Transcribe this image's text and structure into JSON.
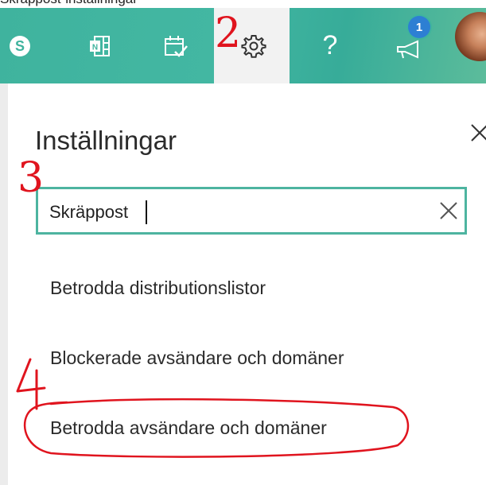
{
  "page": {
    "caption": "Skräppost-inställningar"
  },
  "header": {
    "icons": [
      "skype-icon",
      "onenote-icon",
      "todo-icon",
      "settings-gear-icon",
      "help-icon",
      "announcement-icon",
      "avatar"
    ],
    "help_label": "?",
    "notification_count": "1",
    "colors": {
      "bar": "#43b7a2",
      "active": "#f2f2f2",
      "badge": "#2d7fd3"
    }
  },
  "settings_panel": {
    "title": "Inställningar",
    "search": {
      "value": "Skräppost",
      "placeholder": ""
    },
    "results": [
      {
        "label": "Betrodda distributionslistor"
      },
      {
        "label": "Blockerade avsändare och domäner"
      },
      {
        "label": "Betrodda avsändare och domäner"
      }
    ]
  },
  "annotations": {
    "step_2": "2",
    "step_3": "3",
    "step_4": "4",
    "color": "#e0141e"
  }
}
